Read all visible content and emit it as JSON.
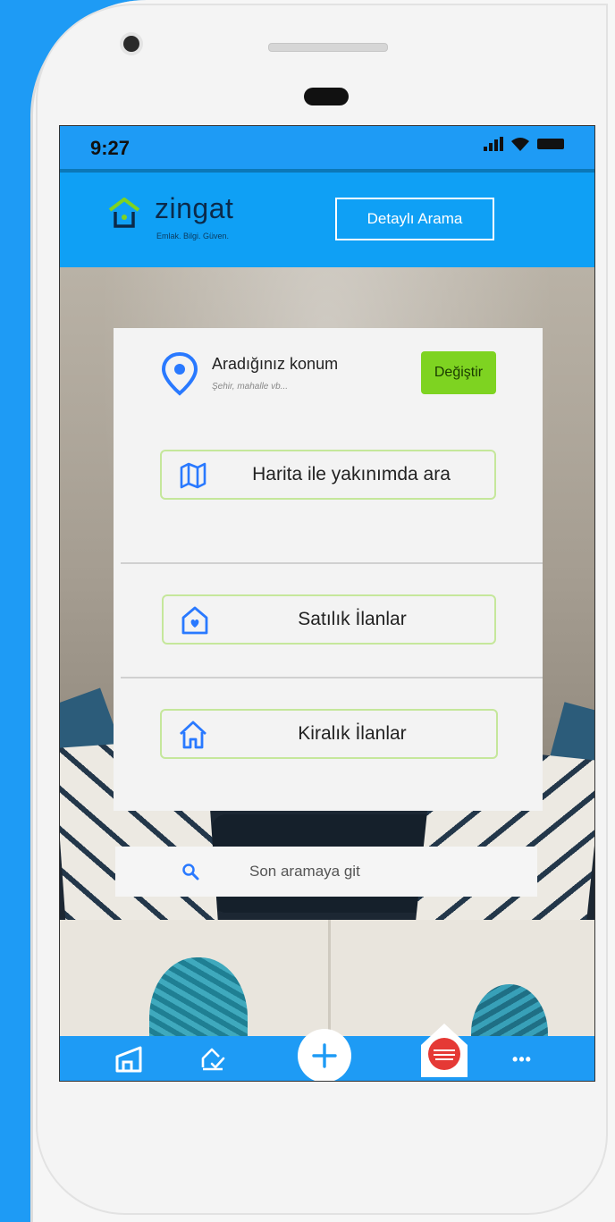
{
  "status_bar": {
    "time": "9:27"
  },
  "header": {
    "brand": "zingat",
    "tagline": "Emlak. Bilgi. Güven.",
    "detail_search_label": "Detaylı Arama"
  },
  "location": {
    "title": "Aradığınız konum",
    "placeholder": "Şehir, mahalle vb...",
    "change_label": "Değiştir"
  },
  "actions": {
    "map_search_label": "Harita ile yakınımda ara",
    "sale_label": "Satılık İlanlar",
    "rent_label": "Kiralık İlanlar"
  },
  "last_search": {
    "label": "Son aramaya git"
  },
  "bottom_nav": {
    "items": [
      "home-outline-icon",
      "checklist-icon",
      "add-icon",
      "badge-icon",
      "more-icon"
    ],
    "more_label": "•••"
  },
  "colors": {
    "brand_blue": "#1e9bf5",
    "accent_green": "#7ed321",
    "outline_green": "#c5e79b",
    "icon_blue": "#2979ff"
  }
}
